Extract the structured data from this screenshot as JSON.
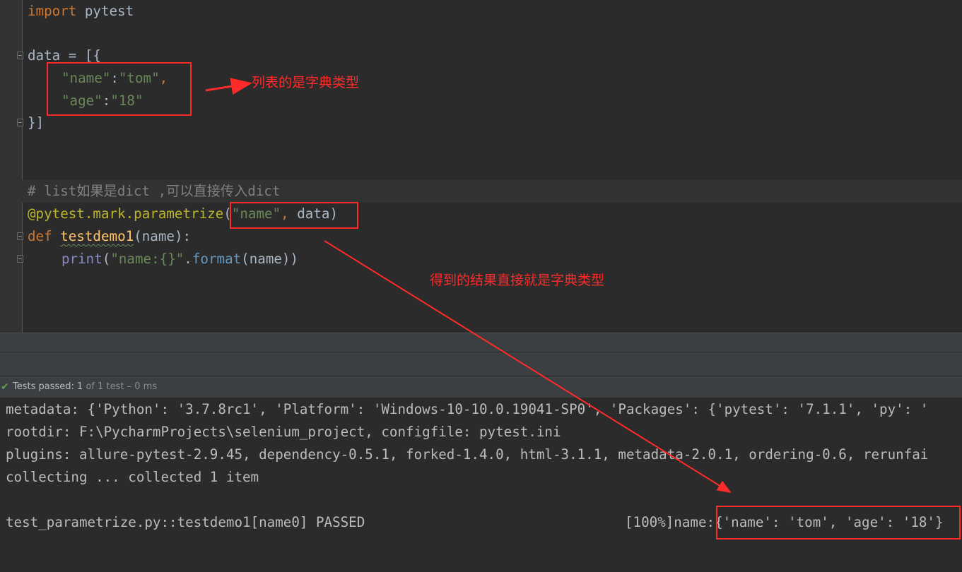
{
  "editor": {
    "l1_import": "import",
    "l1_module": " pytest",
    "l3": "data = [{",
    "l4_key": "\"name\"",
    "l4_colon": ":",
    "l4_val": "\"tom\"",
    "l4_comma": ",",
    "l5_key": "\"age\"",
    "l5_colon": ":",
    "l5_val": "\"18\"",
    "l6": "}]",
    "l8_comment": "# list如果是dict ,可以直接传入dict",
    "l9_decorator": "@pytest.mark.parametrize",
    "l9_open": "(",
    "l9_str": "\"name\"",
    "l9_comma": ",",
    "l9_rest": " data)",
    "l10_def": "def",
    "l10_space": " ",
    "l10_fn": "testdemo1",
    "l10_rest": "(name):",
    "l11_print": "print",
    "l11_open": "(",
    "l11_str": "\"name:{}\"",
    "l11_dot": ".",
    "l11_method": "format",
    "l11_rest": "(name))"
  },
  "test_status": {
    "passed_label": "Tests passed: ",
    "passed_count": "1",
    "of_label": " of 1 test – 0 ms"
  },
  "console": {
    "metadata": "metadata: {'Python': '3.7.8rc1', 'Platform': 'Windows-10-10.0.19041-SP0', 'Packages': {'pytest': '7.1.1', 'py': '",
    "rootdir": "rootdir: F:\\PycharmProjects\\selenium_project, configfile: pytest.ini",
    "plugins": "plugins: allure-pytest-2.9.45, dependency-0.5.1, forked-1.4.0, html-3.1.1, metadata-2.0.1, ordering-0.6, rerunfai",
    "collecting": "collecting ... collected 1 item",
    "result_test": "test_parametrize.py::testdemo1[name0] PASSED",
    "result_progress": "[100%]name:",
    "result_value": "{'name': 'tom', 'age': '18'}"
  },
  "annotations": {
    "list_dict": "列表的是字典类型",
    "result_dict": "得到的结果直接就是字典类型"
  },
  "colors": {
    "highlight": "#ff2a2a",
    "keyword": "#cc7832",
    "string": "#6a8759",
    "function": "#ffc66d",
    "decorator": "#bbb529",
    "comment": "#808080",
    "pass_green": "#5e9e4e"
  },
  "icons": [
    "fold-marker-icon",
    "check-icon"
  ]
}
